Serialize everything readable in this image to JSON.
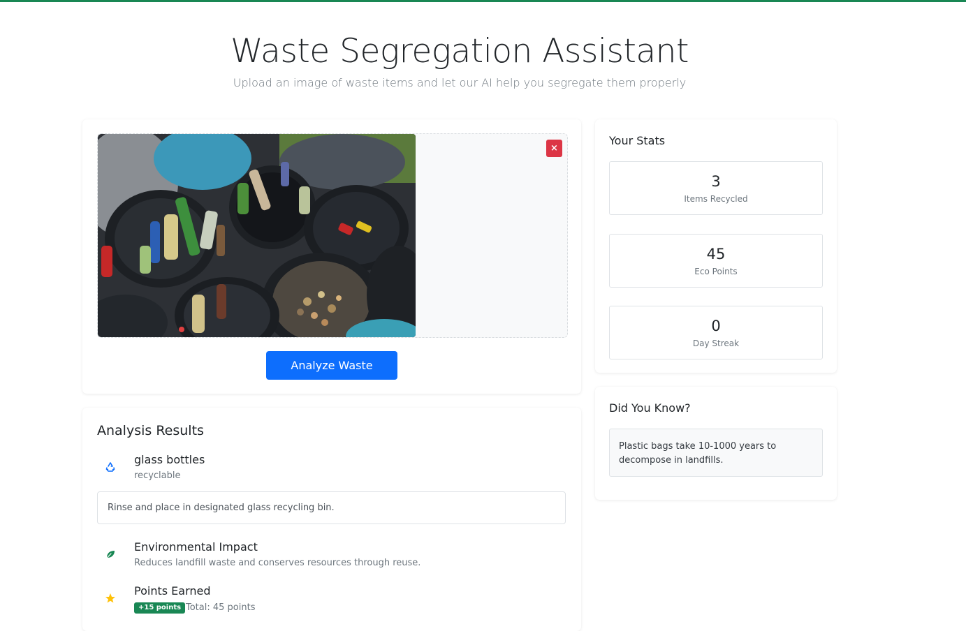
{
  "header": {
    "title": "Waste Segregation Assistant",
    "subtitle": "Upload an image of waste items and let our AI help you segregate them properly"
  },
  "upload": {
    "remove_label": "×",
    "analyze_label": "Analyze Waste"
  },
  "results": {
    "heading": "Analysis Results",
    "item": {
      "icon": "recycle-icon",
      "name": "glass bottles",
      "category": "recyclable",
      "instruction": "Rinse and place in designated glass recycling bin."
    },
    "impact": {
      "icon": "leaf-icon",
      "title": "Environmental Impact",
      "text": "Reduces landfill waste and conserves resources through reuse."
    },
    "points": {
      "icon": "star-icon",
      "title": "Points Earned",
      "badge": "+15 points",
      "total": "Total: 45 points"
    }
  },
  "stats": {
    "heading": "Your Stats",
    "items": [
      {
        "value": "3",
        "label": "Items Recycled"
      },
      {
        "value": "45",
        "label": "Eco Points"
      },
      {
        "value": "0",
        "label": "Day Streak"
      }
    ]
  },
  "tip": {
    "heading": "Did You Know?",
    "text": "Plastic bags take 10-1000 years to decompose in landfills."
  },
  "colors": {
    "primary": "#0d6efd",
    "success": "#198754",
    "danger": "#dc3545",
    "warning": "#ffc107"
  }
}
